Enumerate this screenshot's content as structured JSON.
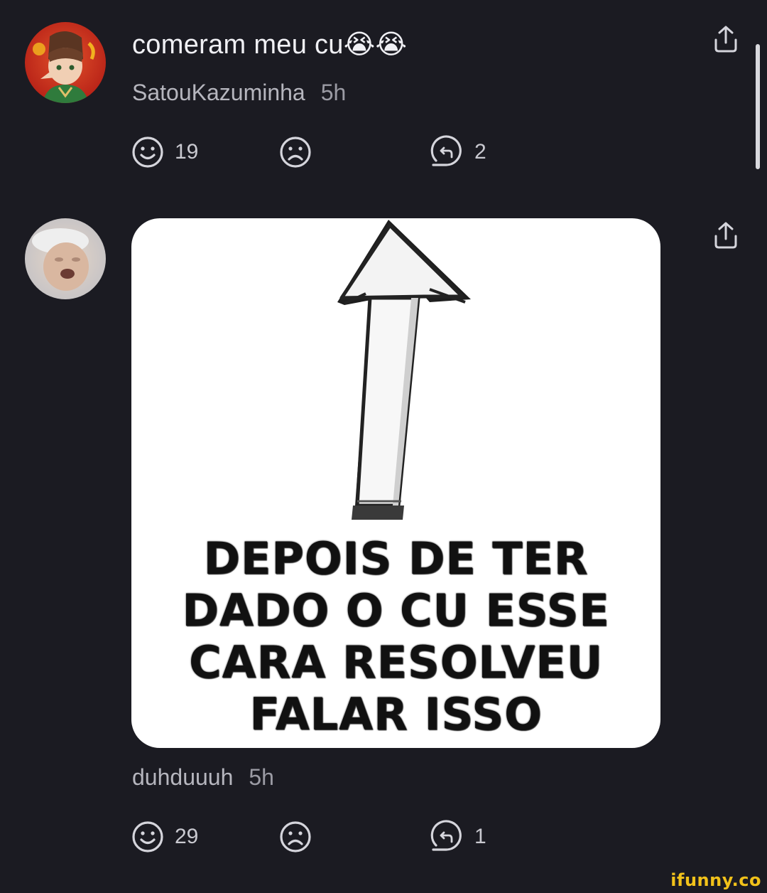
{
  "comments": [
    {
      "text": "comeram meu cu",
      "emojis": "😭😭",
      "username": "SatouKazuminha",
      "time": "5h",
      "smile_count": "19",
      "reply_count": "2"
    },
    {
      "text": "",
      "username": "duhduuuh",
      "time": "5h",
      "smile_count": "29",
      "reply_count": "1",
      "meme": {
        "caption_lines": [
          "DEPOIS DE TER",
          "DADO O CU ESSE",
          "CARA RESOLVEU",
          "FALAR ISSO"
        ]
      }
    }
  ],
  "watermark": "ifunny.co",
  "icons": {
    "smile": "smile-icon",
    "frown": "frown-icon",
    "reply": "reply-icon",
    "share": "share-icon"
  },
  "colors": {
    "background": "#1b1b22",
    "text": "#f0f0f4",
    "muted": "#b6b6be",
    "watermark": "#f2c21a"
  }
}
